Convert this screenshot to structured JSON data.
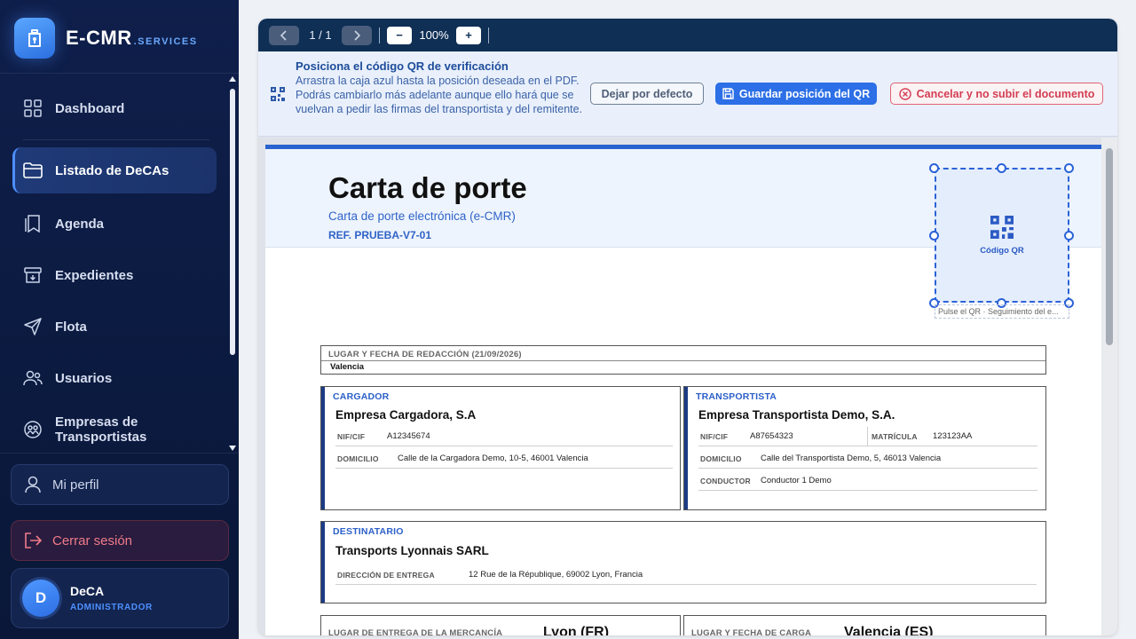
{
  "brand": {
    "name": "E-CMR",
    "suffix": ".SERVICES"
  },
  "sidebar": {
    "items": [
      {
        "label": "Dashboard",
        "icon": "dashboard-grid-icon"
      },
      {
        "label": "Listado de DeCAs",
        "icon": "folder-icon",
        "active": true
      },
      {
        "label": "Agenda",
        "icon": "bookmark-icon"
      },
      {
        "label": "Expedientes",
        "icon": "archive-box-icon"
      },
      {
        "label": "Flota",
        "icon": "send-arrow-icon"
      },
      {
        "label": "Usuarios",
        "icon": "users-icon"
      },
      {
        "label": "Empresas de Transportistas",
        "icon": "companies-icon"
      }
    ],
    "profile_label": "Mi perfil",
    "logout_label": "Cerrar sesión",
    "user": {
      "initial": "D",
      "name": "DeCA",
      "role": "ADMINISTRADOR"
    }
  },
  "toolbar": {
    "page": "1 / 1",
    "zoom": "100%",
    "zoom_out": "−",
    "zoom_in": "+"
  },
  "banner": {
    "title": "Posiciona el código QR de verificación",
    "description": "Arrastra la caja azul hasta la posición deseada en el PDF. Podrás cambiarlo más adelante aunque ello hará que se vuelvan a pedir las firmas del transportista y del remitente.",
    "default_label": "Dejar por defecto",
    "save_label": "Guardar posición del QR",
    "cancel_label": "Cancelar y no subir el documento"
  },
  "document": {
    "title": "Carta de porte",
    "subtitle": "Carta de porte electrónica (e-CMR)",
    "ref": "REF. PRUEBA-V7-01",
    "qr_label": "Código QR",
    "qr_caption": "Pulse el QR · Seguimiento del e...",
    "redaction": {
      "label": "LUGAR Y FECHA DE REDACCIÓN (21/09/2026)",
      "value": "Valencia"
    },
    "cargador": {
      "label": "CARGADOR",
      "name": "Empresa Cargadora, S.A",
      "nif_key": "NIF/CIF",
      "nif": "A12345674",
      "domicilio_key": "DOMICILIO",
      "domicilio": "Calle de la Cargadora Demo, 10-5, 46001 Valencia"
    },
    "transportista": {
      "label": "TRANSPORTISTA",
      "name": "Empresa Transportista Demo, S.A.",
      "nif_key": "NIF/CIF",
      "nif": "A87654323",
      "matricula_key": "MATRÍCULA",
      "matricula": "123123AA",
      "domicilio_key": "DOMICILIO",
      "domicilio": "Calle del Transportista Demo, 5, 46013 Valencia",
      "conductor_key": "CONDUCTOR",
      "conductor": "Conductor 1 Demo"
    },
    "destinatario": {
      "label": "DESTINATARIO",
      "name": "Transports Lyonnais SARL",
      "entrega_key": "DIRECCIÓN DE ENTREGA",
      "entrega": "12 Rue de la République, 69002 Lyon, Francia"
    },
    "entrega_mercancia": {
      "label": "LUGAR DE ENTREGA DE LA MERCANCÍA",
      "value": "Lyon (FR)"
    },
    "carga": {
      "label": "LUGAR Y FECHA DE CARGA",
      "value": "Valencia (ES)"
    }
  },
  "colors": {
    "accent": "#2c6fe6",
    "sidebar_bg": "#0f1f4b",
    "danger": "#d43e52"
  }
}
